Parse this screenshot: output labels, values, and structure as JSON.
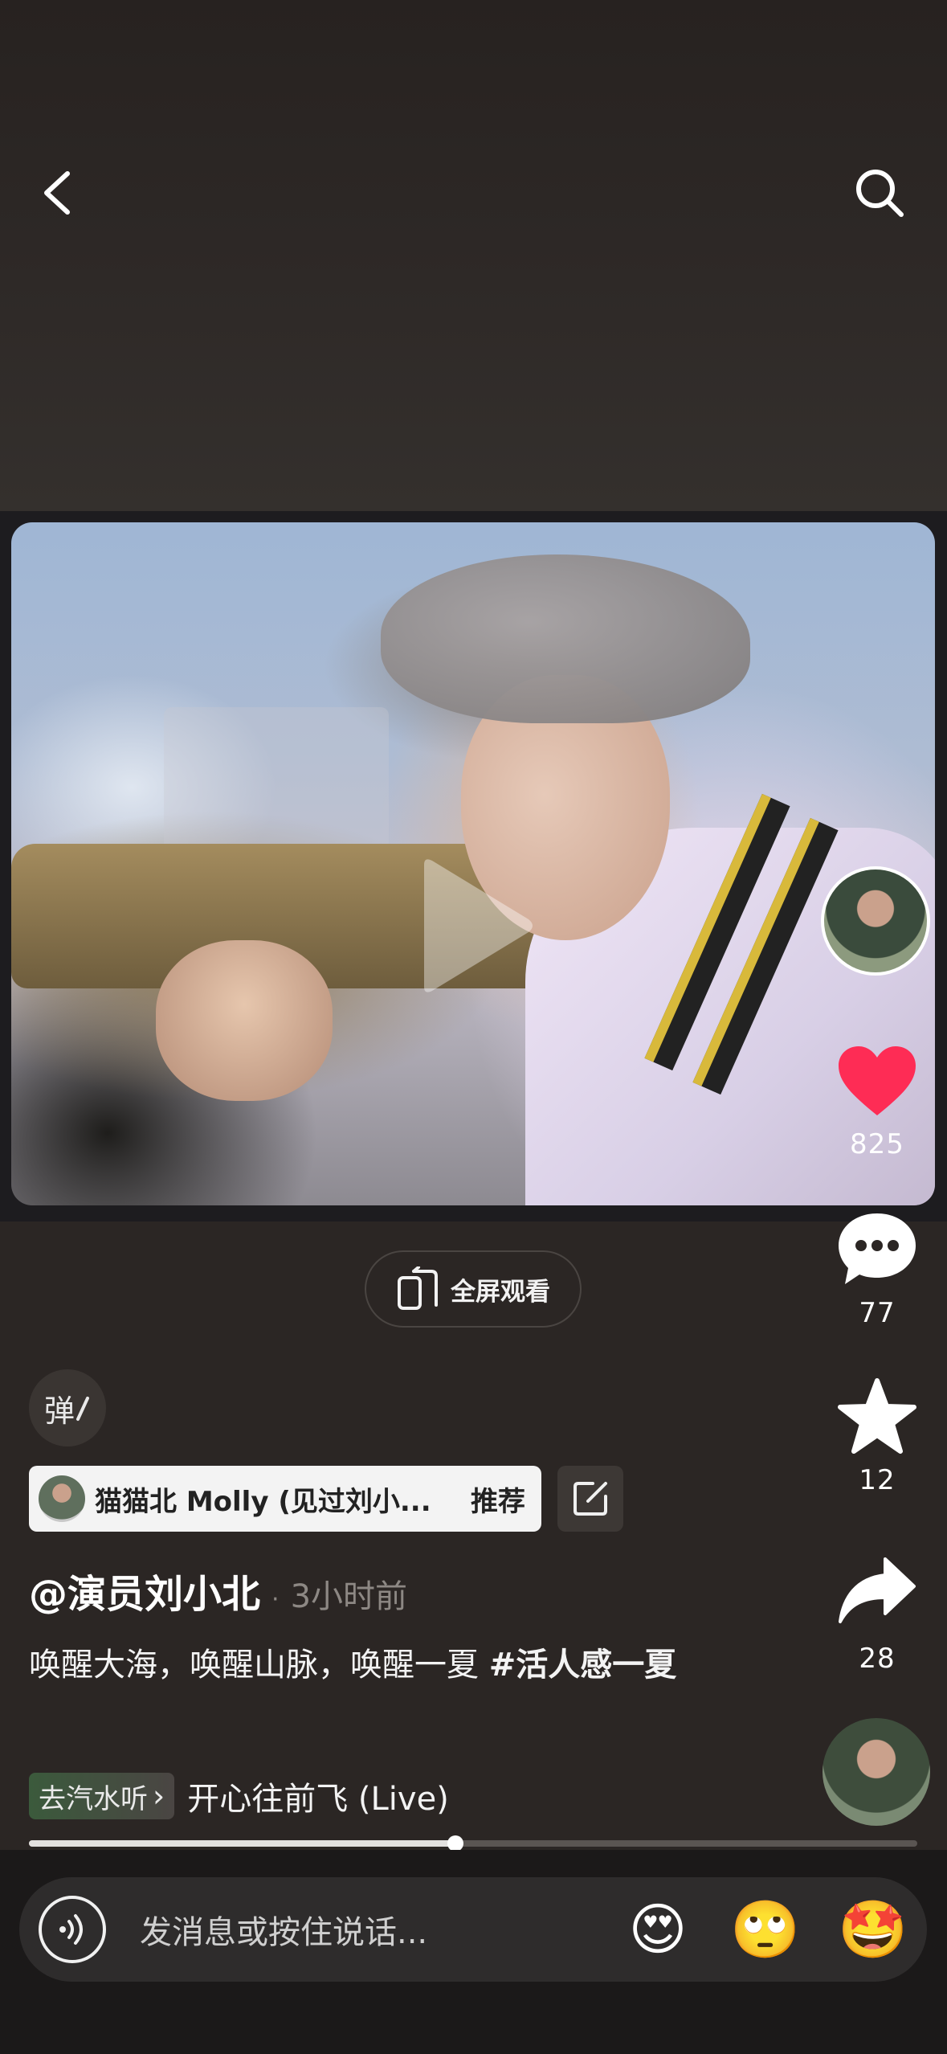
{
  "nav": {
    "back_icon": "chevron-left-icon",
    "search_icon": "search-icon"
  },
  "video": {
    "state": "paused",
    "play_icon": "play-icon"
  },
  "rail": {
    "likes": "825",
    "comments": "77",
    "favorites": "12",
    "shares": "28",
    "like_color": "#fe2c55"
  },
  "fullscreen": {
    "label": "全屏观看"
  },
  "danmu": {
    "label": "弹"
  },
  "recommend": {
    "name": "猫猫北 Molly (见过刘小...",
    "tag": "推荐"
  },
  "post": {
    "author": "@演员刘小北",
    "dot": "·",
    "time": "3小时前",
    "text": "唤醒大海，唤醒山脉，唤醒一夏 ",
    "hashtag": "#活人感一夏"
  },
  "music": {
    "chip": "去汽水听",
    "chip_chevron": "›",
    "title": "开心往前飞 (Live)"
  },
  "progress": {
    "fraction": 0.48
  },
  "message": {
    "placeholder": "发消息或按住说话...",
    "emojis": [
      "😍",
      "🙄",
      "🤩"
    ]
  }
}
